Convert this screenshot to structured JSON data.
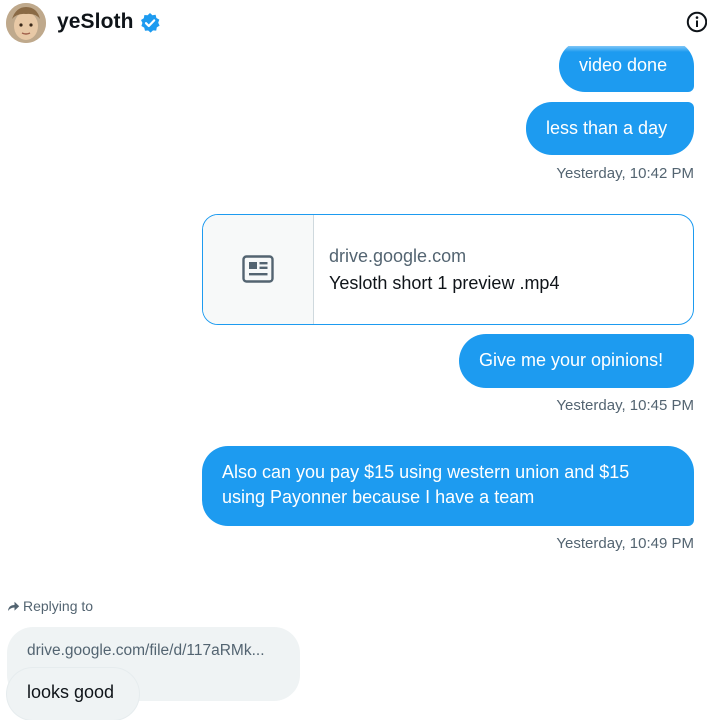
{
  "header": {
    "name": "yeSloth",
    "verified": true,
    "verified_icon": "verified-badge-icon",
    "info_icon": "info-icon",
    "accent_color": "#1d9bf0"
  },
  "messages": [
    {
      "direction": "outgoing",
      "text": "video done"
    },
    {
      "direction": "outgoing",
      "text": "less than a day",
      "timestamp": "Yesterday, 10:42 PM"
    },
    {
      "direction": "outgoing",
      "type": "link-card",
      "domain": "drive.google.com",
      "title": "Yesloth short 1 preview .mp4",
      "icon": "article-icon"
    },
    {
      "direction": "outgoing",
      "text": "Give me your opinions!",
      "timestamp": "Yesterday, 10:45 PM"
    },
    {
      "direction": "outgoing",
      "text": "Also can you pay $15 using western union and $15 using Payonner because I have a team",
      "timestamp": "Yesterday, 10:49 PM"
    }
  ],
  "reply": {
    "label": "Replying to",
    "icon": "reply-arrow-icon",
    "quoted_text": "drive.google.com/file/d/117aRMk...",
    "message": "looks good"
  }
}
